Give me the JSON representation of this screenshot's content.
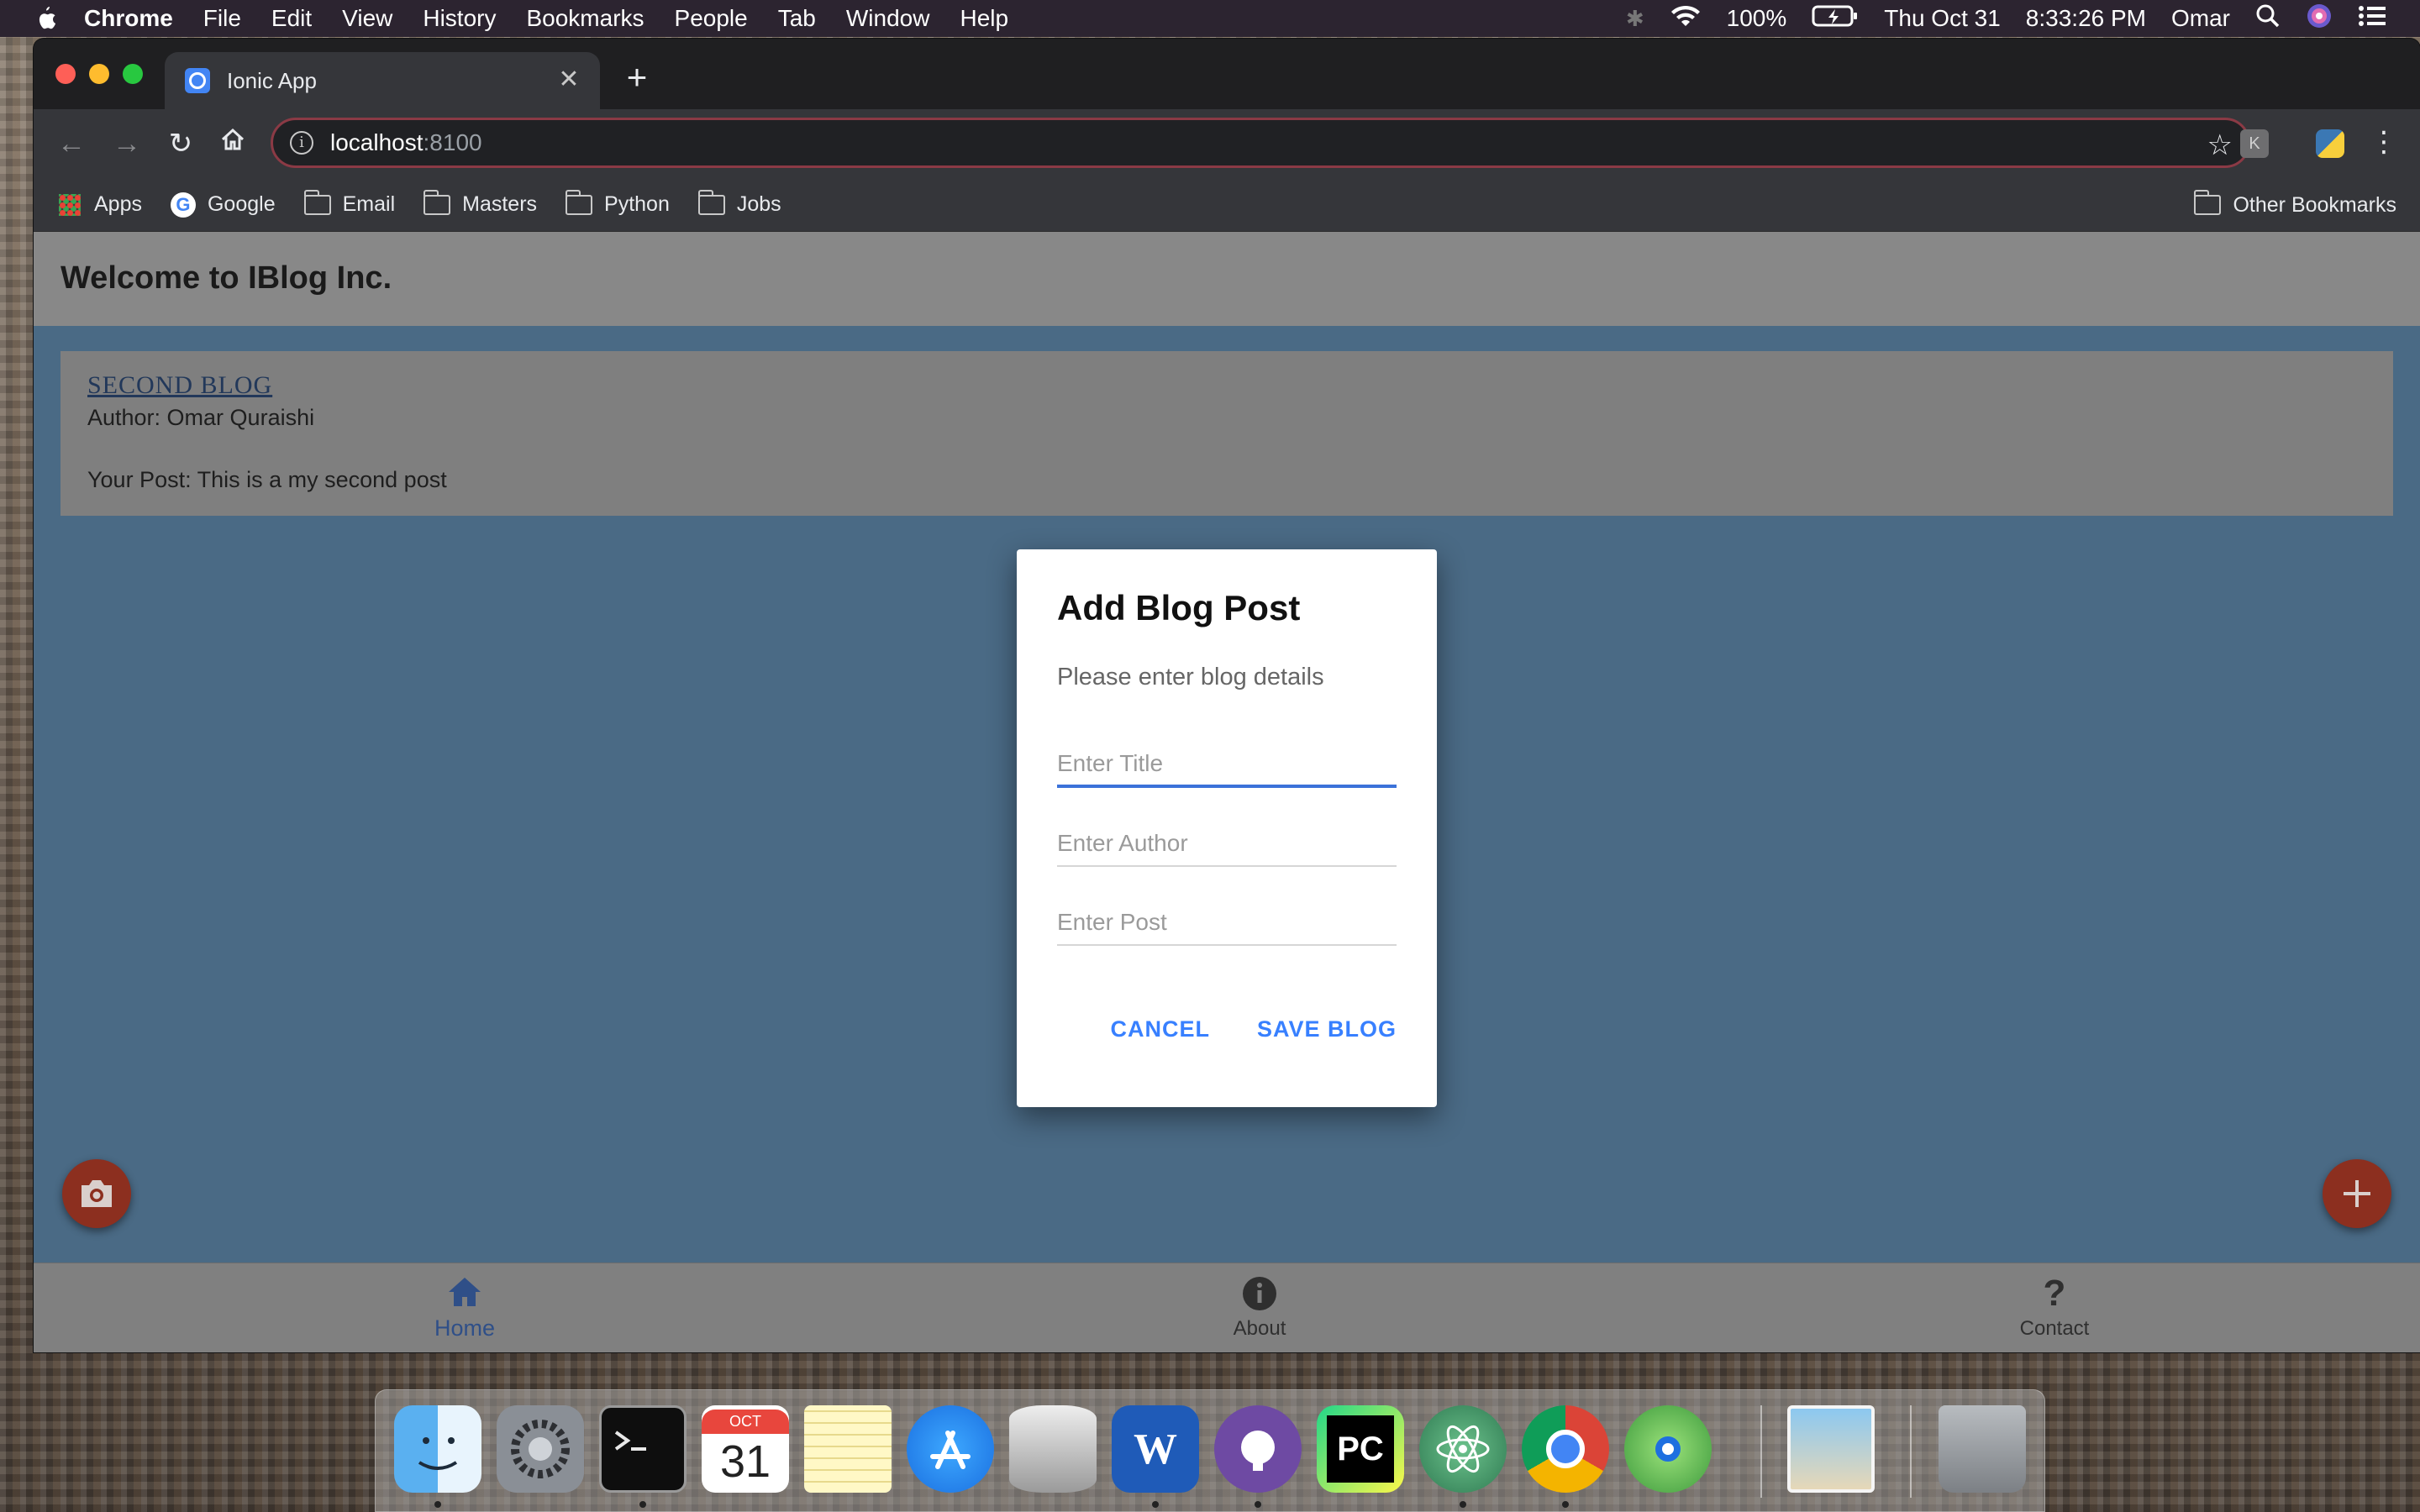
{
  "menubar": {
    "app_name": "Chrome",
    "items": [
      "File",
      "Edit",
      "View",
      "History",
      "Bookmarks",
      "People",
      "Tab",
      "Window",
      "Help"
    ],
    "battery": "100%",
    "date": "Thu Oct 31",
    "time": "8:33:26 PM",
    "user": "Omar"
  },
  "browser": {
    "tab_title": "Ionic App",
    "url_host": "localhost",
    "url_port": ":8100",
    "bookmarks": {
      "apps": "Apps",
      "google": "Google",
      "email": "Email",
      "masters": "Masters",
      "python": "Python",
      "jobs": "Jobs",
      "other": "Other Bookmarks"
    }
  },
  "page": {
    "header_title": "Welcome to IBlog Inc.",
    "card": {
      "title": "SECOND BLOG",
      "author": "Author: Omar Quraishi",
      "post": "Your Post: This is a my second post"
    },
    "tabs": {
      "home": "Home",
      "about": "About",
      "contact": "Contact"
    }
  },
  "dialog": {
    "title": "Add Blog Post",
    "subtitle": "Please enter blog details",
    "title_placeholder": "Enter Title",
    "author_placeholder": "Enter Author",
    "post_placeholder": "Enter Post",
    "cancel_label": "CANCEL",
    "save_label": "SAVE BLOG"
  },
  "dock": {
    "calendar_month": "OCT",
    "calendar_day": "31",
    "pycharm_label": "PC"
  },
  "colors": {
    "ionic_primary": "#3880ff",
    "fab_red": "#8c2f1f",
    "content_blue": "#4a6a85"
  }
}
